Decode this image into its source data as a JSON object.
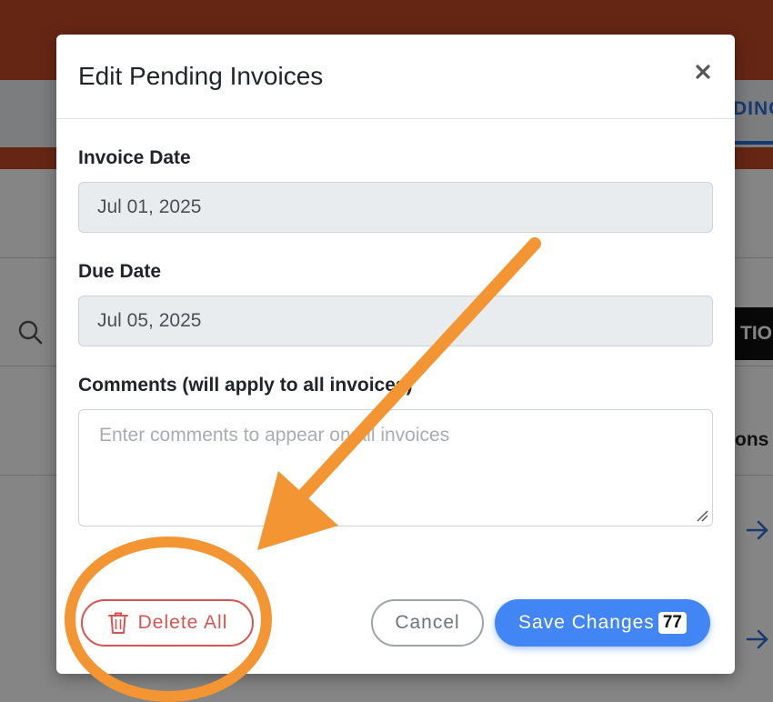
{
  "background": {
    "tab_fragment": "DINC",
    "button_fragment": "TION",
    "column_fragment": "ons"
  },
  "modal": {
    "title": "Edit Pending Invoices",
    "close_glyph": "×",
    "invoice_date": {
      "label": "Invoice Date",
      "value": "Jul 01, 2025"
    },
    "due_date": {
      "label": "Due Date",
      "value": "Jul 05, 2025"
    },
    "comments": {
      "label": "Comments (will apply to all invoices)",
      "placeholder": "Enter comments to appear on all invoices",
      "value": ""
    },
    "buttons": {
      "delete_all": "Delete All",
      "cancel": "Cancel",
      "save_changes": "Save Changes",
      "save_badge": "77"
    }
  },
  "colors": {
    "header_brand": "#c34a28",
    "primary": "#4285f4",
    "danger": "#d9534f",
    "annotation": "#f39533"
  },
  "icons": [
    "search-icon",
    "arrow-right-icon",
    "close-icon",
    "trash-icon",
    "resize-handle-icon"
  ]
}
